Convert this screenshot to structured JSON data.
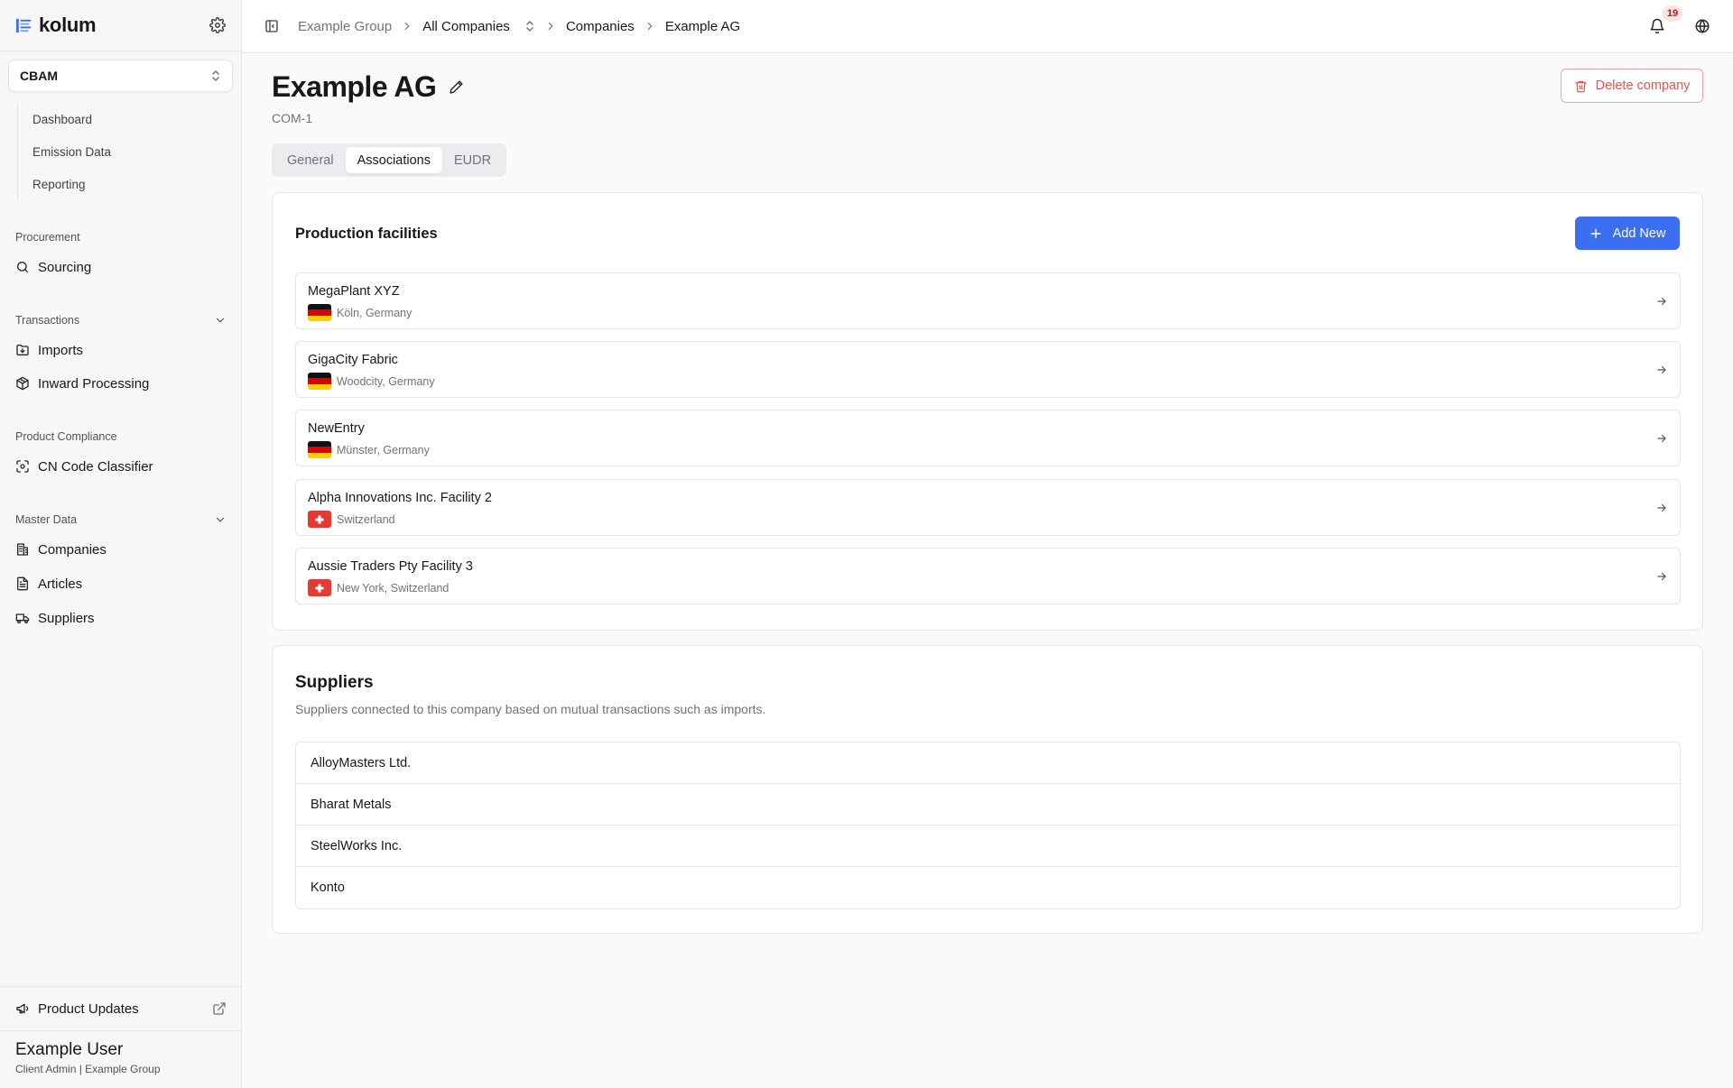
{
  "app": {
    "name": "kolum"
  },
  "module_selector": {
    "label": "CBAM"
  },
  "module_nav": [
    {
      "label": "Dashboard"
    },
    {
      "label": "Emission Data"
    },
    {
      "label": "Reporting"
    }
  ],
  "sidebar": {
    "procurement": {
      "title": "Procurement",
      "items": [
        {
          "label": "Sourcing",
          "icon": "search-icon"
        }
      ]
    },
    "transactions": {
      "title": "Transactions",
      "items": [
        {
          "label": "Imports",
          "icon": "import-folder-icon"
        },
        {
          "label": "Inward Processing",
          "icon": "package-icon"
        }
      ]
    },
    "product_compliance": {
      "title": "Product Compliance",
      "items": [
        {
          "label": "CN Code Classifier",
          "icon": "scan-icon"
        }
      ]
    },
    "master_data": {
      "title": "Master Data",
      "items": [
        {
          "label": "Companies",
          "icon": "building-icon"
        },
        {
          "label": "Articles",
          "icon": "document-icon"
        },
        {
          "label": "Suppliers",
          "icon": "truck-icon"
        }
      ]
    },
    "product_updates": {
      "label": "Product Updates"
    },
    "user": {
      "name": "Example User",
      "role": "Client Admin | Example Group"
    }
  },
  "breadcrumb": [
    "Example Group",
    "All Companies",
    "Companies",
    "Example AG"
  ],
  "notifications": {
    "count": "19"
  },
  "company": {
    "name": "Example AG",
    "code": "COM-1"
  },
  "actions": {
    "delete_label": "Delete company",
    "add_new_label": "Add New"
  },
  "tabs": [
    {
      "label": "General",
      "active": false
    },
    {
      "label": "Associations",
      "active": true
    },
    {
      "label": "EUDR",
      "active": false
    }
  ],
  "production_facilities": {
    "title": "Production facilities",
    "items": [
      {
        "name": "MegaPlant XYZ",
        "location": "Köln, Germany",
        "flag": "de"
      },
      {
        "name": "GigaCity Fabric",
        "location": "Woodcity, Germany",
        "flag": "de"
      },
      {
        "name": "NewEntry",
        "location": "Münster, Germany",
        "flag": "de"
      },
      {
        "name": "Alpha Innovations Inc. Facility 2",
        "location": "Switzerland",
        "flag": "ch"
      },
      {
        "name": "Aussie Traders Pty Facility 3",
        "location": "New York, Switzerland",
        "flag": "ch"
      }
    ]
  },
  "suppliers": {
    "title": "Suppliers",
    "description": "Suppliers connected to this company based on mutual transactions such as imports.",
    "items": [
      {
        "name": "AlloyMasters Ltd."
      },
      {
        "name": "Bharat Metals"
      },
      {
        "name": "SteelWorks Inc."
      },
      {
        "name": "Konto"
      }
    ]
  },
  "colors": {
    "primary": "#3b6ff0",
    "danger": "#e25555",
    "badge_bg": "#fde2e2"
  }
}
